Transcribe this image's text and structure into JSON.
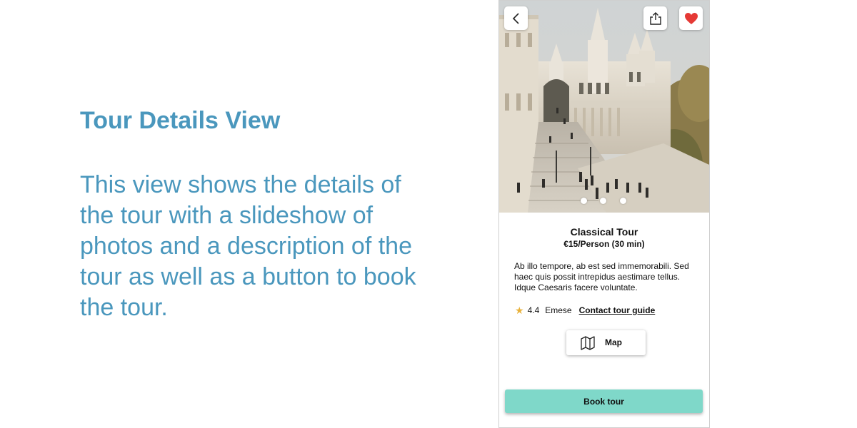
{
  "slide": {
    "title": "Tour Details View",
    "body": "This view shows the details of the tour with a slideshow of photos and a description of the tour as well as a button to book the tour."
  },
  "phone": {
    "topbar": {
      "back_icon": "chevron-left-icon",
      "share_icon": "share-icon",
      "favorite_icon": "heart-icon",
      "favorite_color": "#e53935"
    },
    "slideshow": {
      "dot_count": 3,
      "active_index": 0
    },
    "tour": {
      "name": "Classical Tour",
      "price": "€15/Person (30 min)",
      "description": "Ab illo tempore, ab est sed immemorabili. Sed haec quis possit intrepidus aestimare tellus. Idque Caesaris facere voluntate.",
      "rating": "4.4",
      "guide_name": "Emese",
      "contact_label": "Contact tour guide"
    },
    "map_button": {
      "icon": "map-icon",
      "label": "Map"
    },
    "book_button": {
      "label": "Book tour",
      "color": "#7fd8c9"
    }
  },
  "colors": {
    "accent_text": "#4a97bd",
    "star": "#e8b13a"
  }
}
